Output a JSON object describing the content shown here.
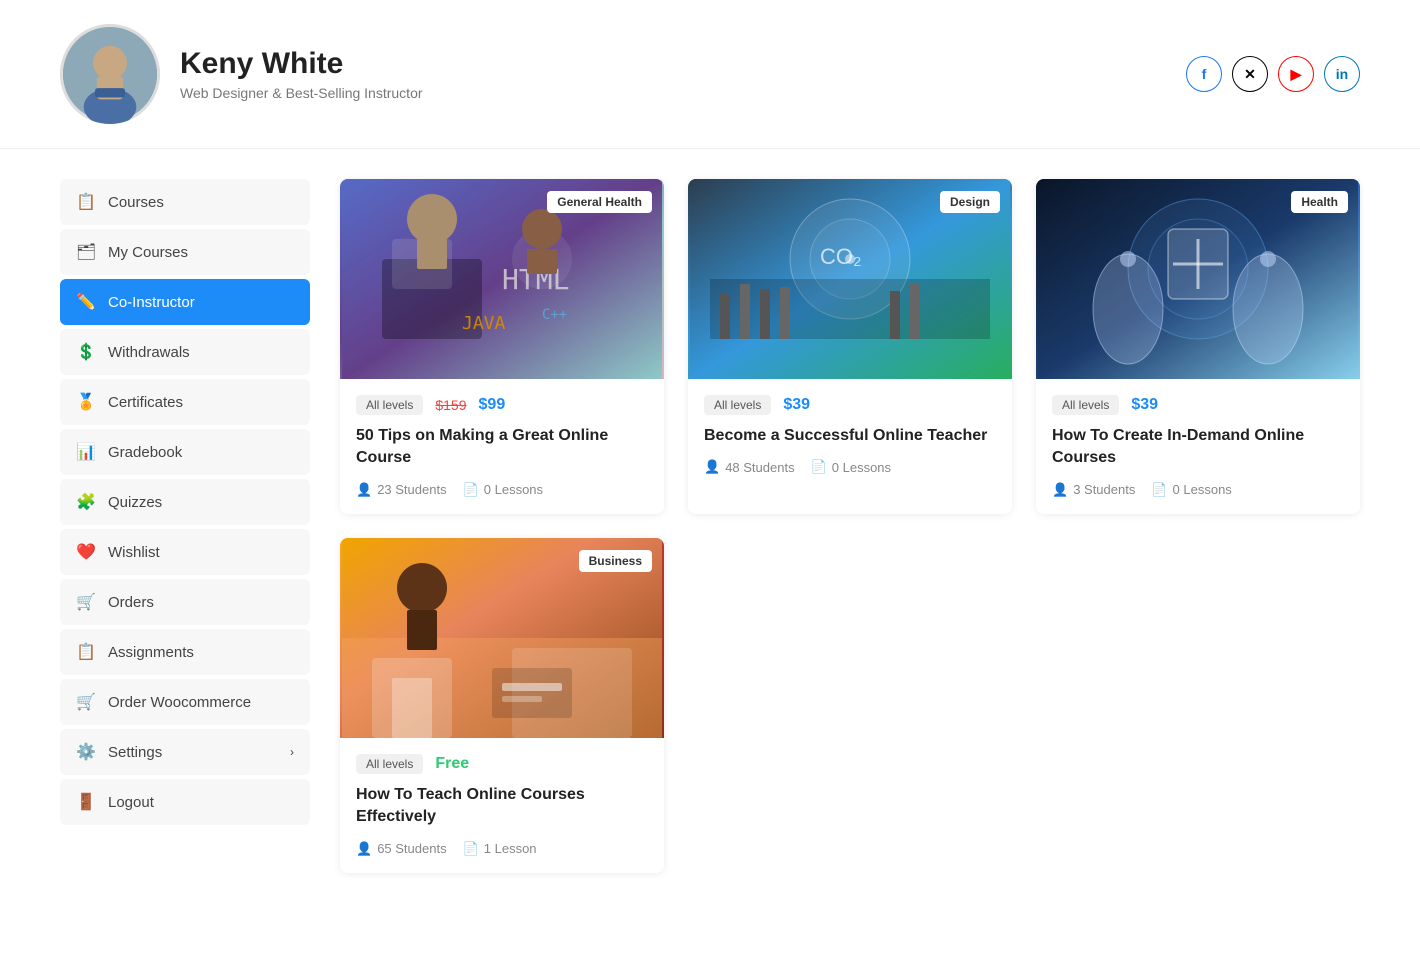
{
  "header": {
    "user_name": "Keny White",
    "user_title": "Web Designer & Best-Selling Instructor",
    "avatar_initial": "👤",
    "social": [
      {
        "id": "fb",
        "label": "f",
        "class": "fb"
      },
      {
        "id": "x",
        "label": "𝕏",
        "class": "x"
      },
      {
        "id": "yt",
        "label": "▶",
        "class": "yt"
      },
      {
        "id": "li",
        "label": "in",
        "class": "li"
      }
    ]
  },
  "sidebar": {
    "items": [
      {
        "id": "courses",
        "label": "Courses",
        "icon": "📋",
        "active": false,
        "arrow": false
      },
      {
        "id": "my-courses",
        "label": "My Courses",
        "icon": "🗂",
        "active": false,
        "arrow": false
      },
      {
        "id": "co-instructor",
        "label": "Co-Instructor",
        "icon": "✏️",
        "active": true,
        "arrow": false
      },
      {
        "id": "withdrawals",
        "label": "Withdrawals",
        "icon": "💲",
        "active": false,
        "arrow": false
      },
      {
        "id": "certificates",
        "label": "Certificates",
        "icon": "🏅",
        "active": false,
        "arrow": false
      },
      {
        "id": "gradebook",
        "label": "Gradebook",
        "icon": "📊",
        "active": false,
        "arrow": false
      },
      {
        "id": "quizzes",
        "label": "Quizzes",
        "icon": "🧩",
        "active": false,
        "arrow": false
      },
      {
        "id": "wishlist",
        "label": "Wishlist",
        "icon": "❤️",
        "active": false,
        "arrow": false
      },
      {
        "id": "orders",
        "label": "Orders",
        "icon": "🛒",
        "active": false,
        "arrow": false
      },
      {
        "id": "assignments",
        "label": "Assignments",
        "icon": "📋",
        "active": false,
        "arrow": false
      },
      {
        "id": "order-woocommerce",
        "label": "Order Woocommerce",
        "icon": "🛒",
        "active": false,
        "arrow": false
      },
      {
        "id": "settings",
        "label": "Settings",
        "icon": "⚙️",
        "active": false,
        "arrow": true
      },
      {
        "id": "logout",
        "label": "Logout",
        "icon": "🚪",
        "active": false,
        "arrow": false
      }
    ]
  },
  "courses": [
    {
      "id": "course-1",
      "badge": "General Health",
      "level": "All levels",
      "price_old": "$159",
      "price": "$99",
      "price_free": false,
      "title": "50 Tips on Making a Great Online Course",
      "students": "23 Students",
      "lessons": "0 Lessons",
      "image_class": "img-general-health"
    },
    {
      "id": "course-2",
      "badge": "Design",
      "level": "All levels",
      "price_old": "",
      "price": "$39",
      "price_free": false,
      "title": "Become a Successful Online Teacher",
      "students": "48 Students",
      "lessons": "0 Lessons",
      "image_class": "img-design"
    },
    {
      "id": "course-3",
      "badge": "Health",
      "level": "All levels",
      "price_old": "",
      "price": "$39",
      "price_free": false,
      "title": "How To Create In-Demand Online Courses",
      "students": "3 Students",
      "lessons": "0 Lessons",
      "image_class": "img-health"
    },
    {
      "id": "course-4",
      "badge": "Business",
      "level": "All levels",
      "price_old": "",
      "price": "Free",
      "price_free": true,
      "title": "How To Teach Online Courses Effectively",
      "students": "65 Students",
      "lessons": "1 Lesson",
      "image_class": "img-business"
    }
  ]
}
